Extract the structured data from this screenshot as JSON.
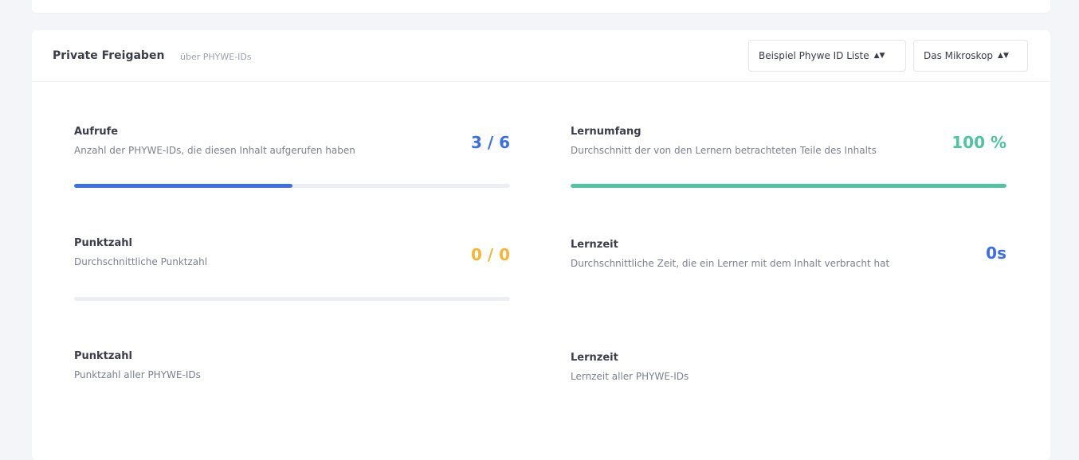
{
  "header": {
    "title": "Private Freigaben",
    "subtitle": "über PHYWE-IDs",
    "select_list": "Beispiel Phywe ID Liste",
    "select_content": "Das Mikroskop"
  },
  "metrics": {
    "aufrufe": {
      "title": "Aufrufe",
      "description": "Anzahl der PHYWE-IDs, die diesen Inhalt aufgerufen haben",
      "value": "3 / 6",
      "progress": 0.5,
      "color": "#3b6ee8"
    },
    "lernumfang": {
      "title": "Lernumfang",
      "description": "Durchschnitt der von den Lernern betrachteten Teile des Inhalts",
      "value": "100 %",
      "progress": 1.0,
      "color": "#4fc4a3"
    },
    "punktzahl": {
      "title": "Punktzahl",
      "description": "Durchschnittliche Punktzahl",
      "value": "0 / 0",
      "progress": 0.0,
      "color": "#f5b731"
    },
    "lernzeit": {
      "title": "Lernzeit",
      "description": "Durchschnittliche Zeit, die ein Lerner mit dem Inhalt verbracht hat",
      "value": "0s",
      "color": "#3b6ee8"
    },
    "punktzahl_all": {
      "title": "Punktzahl",
      "description": "Punktzahl aller PHYWE-IDs"
    },
    "lernzeit_all": {
      "title": "Lernzeit",
      "description": "Lernzeit aller PHYWE-IDs"
    }
  },
  "icons": {
    "select_caret": "sort-caret-icon"
  }
}
